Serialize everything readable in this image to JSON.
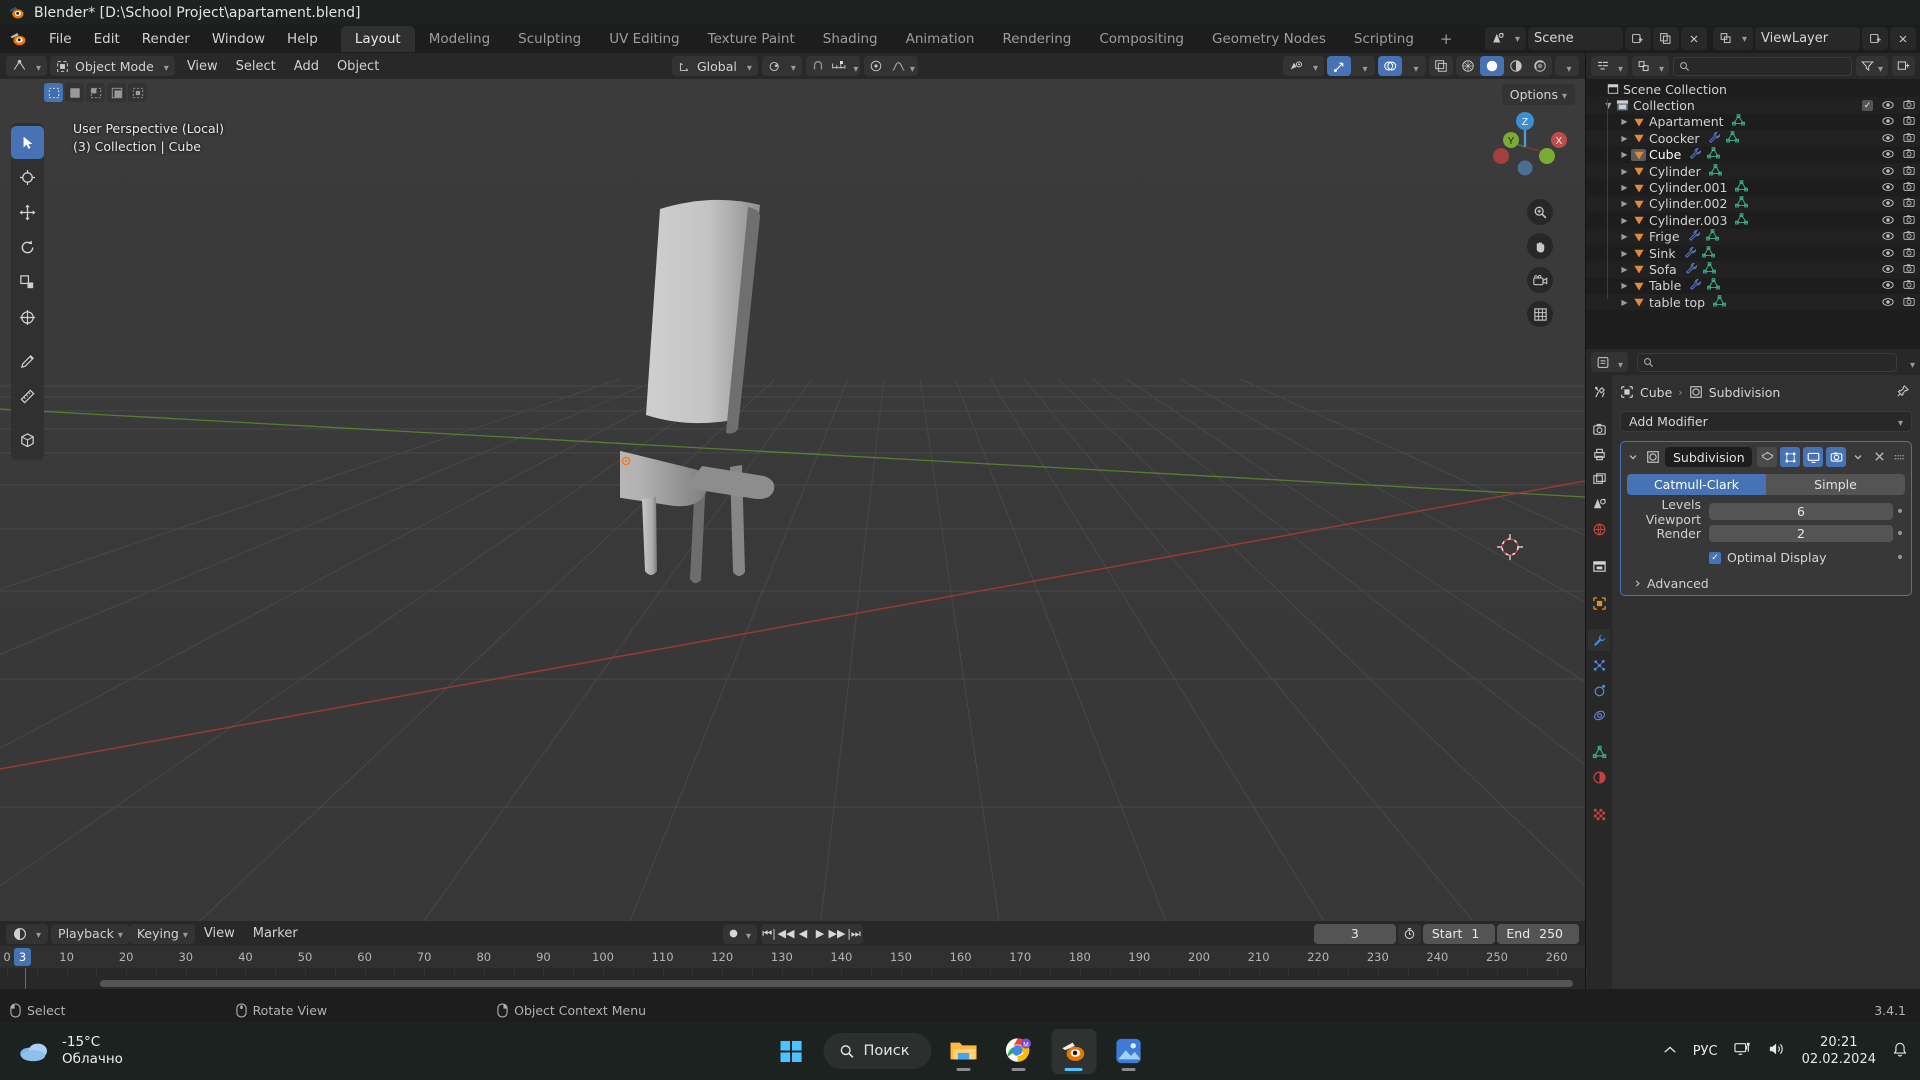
{
  "window": {
    "title": "Blender* [D:\\School Project\\apartament.blend]",
    "logo_icon": "blender-logo-icon"
  },
  "topbar": {
    "menus": [
      "File",
      "Edit",
      "Render",
      "Window",
      "Help"
    ],
    "workspaces": [
      {
        "label": "Layout",
        "active": true
      },
      {
        "label": "Modeling",
        "active": false
      },
      {
        "label": "Sculpting",
        "active": false
      },
      {
        "label": "UV Editing",
        "active": false
      },
      {
        "label": "Texture Paint",
        "active": false
      },
      {
        "label": "Shading",
        "active": false
      },
      {
        "label": "Animation",
        "active": false
      },
      {
        "label": "Rendering",
        "active": false
      },
      {
        "label": "Compositing",
        "active": false
      },
      {
        "label": "Geometry Nodes",
        "active": false
      },
      {
        "label": "Scripting",
        "active": false
      }
    ],
    "add_workspace_label": "+",
    "scene_name": "Scene",
    "viewlayer_name": "ViewLayer",
    "scene_icon": "scene-data-icon",
    "viewlayer_icon": "view-layer-icon",
    "new_scene_icon": "new-scene-icon",
    "copy_scene_icon": "copy-scene-icon",
    "delete_scene_icon": "delete-scene-icon",
    "new_viewlayer_icon": "new-viewlayer-icon",
    "delete_viewlayer_icon": "delete-viewlayer-icon"
  },
  "viewport": {
    "mode": "Object Mode",
    "mode_icon": "object-mode-icon",
    "editor_type_icon": "editor-type-3dview-icon",
    "menus": [
      "View",
      "Select",
      "Add",
      "Object"
    ],
    "transform_orientation": "Global",
    "orientation_icon": "transform-orientation-icon",
    "pivot_icon": "pivot-point-icon",
    "snap_icon": "snap-magnet-icon",
    "snap_target_icon": "snap-increment-icon",
    "proportional_icon": "proportional-edit-icon",
    "proportional_falloff_icon": "falloff-smooth-icon",
    "options_label": "Options",
    "select_modes": [
      "select-set-icon",
      "select-extend-icon",
      "select-subtract-icon",
      "select-invert-icon",
      "select-intersect-icon"
    ],
    "overlay_text_line1": "User Perspective (Local)",
    "overlay_text_line2": "(3) Collection | Cube",
    "gizmo_axes": [
      "X",
      "Y",
      "Z"
    ],
    "nav_buttons": [
      "zoom-icon",
      "pan-hand-icon",
      "camera-view-icon",
      "toggle-ortho-icon"
    ],
    "shading_modes": [
      "wireframe-icon",
      "solid-icon",
      "material-preview-icon",
      "rendered-icon"
    ],
    "active_shading_mode": "solid-icon",
    "header_right_toggles": [
      "visibility-eye-icon",
      "gizmo-toggle-icon",
      "overlays-toggle-icon",
      "xray-toggle-icon"
    ],
    "tools": [
      {
        "name": "tweak-select-box-tool",
        "active": true
      },
      {
        "name": "cursor-tool",
        "active": false
      },
      {
        "name": "move-tool",
        "active": false
      },
      {
        "name": "rotate-tool",
        "active": false
      },
      {
        "name": "scale-tool",
        "active": false
      },
      {
        "name": "transform-tool",
        "active": false
      },
      {
        "name": "annotate-tool",
        "active": false
      },
      {
        "name": "measure-tool",
        "active": false
      },
      {
        "name": "add-cube-tool",
        "active": false
      }
    ],
    "colors": {
      "background": "#393939",
      "grid": "#4b4b4b",
      "axis_x": "#a33b3b",
      "axis_y": "#5a8a2e",
      "object_origin": "#ef7b2f",
      "cursor": "#ffffff"
    }
  },
  "outliner": {
    "display_mode_icon": "outliner-view-layer-icon",
    "filter_icon": "filter-funnel-icon",
    "search_icon": "search-icon",
    "new_collection_icon": "new-collection-icon",
    "root": {
      "label": "Scene Collection",
      "icon": "scene-collection-icon"
    },
    "collection": {
      "label": "Collection",
      "icon": "collection-icon",
      "checked": true
    },
    "items": [
      {
        "label": "Apartament",
        "icon": "mesh-object-icon",
        "has_modifier": false,
        "has_mesh_data": true,
        "selected": false
      },
      {
        "label": "Coocker",
        "icon": "mesh-object-icon",
        "has_modifier": true,
        "has_mesh_data": true,
        "selected": false
      },
      {
        "label": "Cube",
        "icon": "mesh-object-icon",
        "has_modifier": true,
        "has_mesh_data": true,
        "selected": true
      },
      {
        "label": "Cylinder",
        "icon": "mesh-object-icon",
        "has_modifier": false,
        "has_mesh_data": true,
        "selected": false
      },
      {
        "label": "Cylinder.001",
        "icon": "mesh-object-icon",
        "has_modifier": false,
        "has_mesh_data": true,
        "selected": false
      },
      {
        "label": "Cylinder.002",
        "icon": "mesh-object-icon",
        "has_modifier": false,
        "has_mesh_data": true,
        "selected": false
      },
      {
        "label": "Cylinder.003",
        "icon": "mesh-object-icon",
        "has_modifier": false,
        "has_mesh_data": true,
        "selected": false
      },
      {
        "label": "Frige",
        "icon": "mesh-object-icon",
        "has_modifier": true,
        "has_mesh_data": true,
        "selected": false
      },
      {
        "label": "Sink",
        "icon": "mesh-object-icon",
        "has_modifier": true,
        "has_mesh_data": true,
        "selected": false
      },
      {
        "label": "Sofa",
        "icon": "mesh-object-icon",
        "has_modifier": true,
        "has_mesh_data": true,
        "selected": false
      },
      {
        "label": "Table",
        "icon": "mesh-object-icon",
        "has_modifier": true,
        "has_mesh_data": true,
        "selected": false
      },
      {
        "label": "table top",
        "icon": "mesh-object-icon",
        "has_modifier": false,
        "has_mesh_data": true,
        "selected": false
      }
    ],
    "row_icons": {
      "eye": "hide-eye-icon",
      "camera": "disable-render-camera-icon"
    }
  },
  "properties": {
    "editor_icon": "editor-type-properties-icon",
    "search_icon": "search-icon",
    "breadcrumb": {
      "object": "Cube",
      "object_icon": "object-data-icon",
      "separator": "›",
      "modifier": "Subdivision",
      "modifier_icon": "modifier-subsurf-icon",
      "pin_icon": "pin-icon"
    },
    "add_modifier_label": "Add Modifier",
    "add_modifier_chevron_icon": "chevron-down-icon",
    "tabs": [
      {
        "name": "tool-tab",
        "icon": "tool-screwdriver-wrench-icon",
        "active": false
      },
      {
        "name": "render-tab",
        "icon": "render-camera-back-icon",
        "active": false
      },
      {
        "name": "output-tab",
        "icon": "output-printer-icon",
        "active": false
      },
      {
        "name": "view-layer-tab",
        "icon": "view-layer-images-icon",
        "active": false
      },
      {
        "name": "scene-tab",
        "icon": "scene-cone-icon",
        "active": false
      },
      {
        "name": "world-tab",
        "icon": "world-globe-icon",
        "active": false
      },
      {
        "name": "collection-tab",
        "icon": "collection-box-icon",
        "active": false
      },
      {
        "name": "object-tab",
        "icon": "object-square-icon",
        "active": false
      },
      {
        "name": "modifier-tab",
        "icon": "modifier-wrench-icon",
        "active": true
      },
      {
        "name": "particles-tab",
        "icon": "particles-icon",
        "active": false
      },
      {
        "name": "physics-tab",
        "icon": "physics-orbit-icon",
        "active": false
      },
      {
        "name": "constraints-tab",
        "icon": "object-constraints-icon",
        "active": false
      },
      {
        "name": "data-tab",
        "icon": "mesh-data-triangle-icon",
        "active": false
      },
      {
        "name": "material-tab",
        "icon": "material-sphere-icon",
        "active": false
      },
      {
        "name": "texture-tab",
        "icon": "texture-checker-icon",
        "active": false
      }
    ],
    "modifier": {
      "expand_icon": "chevron-down-icon",
      "type_icon": "modifier-subsurf-icon",
      "name": "Subdivision",
      "toggles": [
        {
          "name": "on-cage-toggle",
          "icon": "on-cage-icon",
          "on": false
        },
        {
          "name": "edit-mode-toggle",
          "icon": "edit-mode-display-icon",
          "on": true
        },
        {
          "name": "realtime-toggle",
          "icon": "display-in-viewport-icon",
          "on": true
        },
        {
          "name": "render-toggle",
          "icon": "render-camera-icon",
          "on": true
        }
      ],
      "extras_icon": "chevron-down-icon",
      "close_icon": "close-x-icon",
      "drag_icon": "drag-dots-icon",
      "algorithm_options": [
        "Catmull-Clark",
        "Simple"
      ],
      "algorithm_selected": "Catmull-Clark",
      "fields": [
        {
          "label": "Levels Viewport",
          "value": "6"
        },
        {
          "label": "Render",
          "value": "2"
        }
      ],
      "optimal_display_label": "Optimal Display",
      "optimal_display_checked": true,
      "advanced_label": "Advanced",
      "advanced_expanded": false,
      "advanced_icon": "chevron-right-icon"
    },
    "accent_color": "#4772b3"
  },
  "timeline": {
    "editor_icon": "editor-type-timeline-icon",
    "menus": [
      "Playback",
      "Keying",
      "View",
      "Marker"
    ],
    "record_icon": "auto-keying-record-icon",
    "transport": [
      "jump-to-start-icon",
      "jump-to-prev-keyframe-icon",
      "play-reverse-icon",
      "play-icon",
      "jump-to-next-keyframe-icon",
      "jump-to-end-icon"
    ],
    "current_frame": "3",
    "frame_icon": "stopwatch-icon",
    "start_label": "Start",
    "start_value": "1",
    "end_label": "End",
    "end_value": "250",
    "ruler_ticks": [
      "0",
      "10",
      "20",
      "30",
      "40",
      "50",
      "60",
      "70",
      "80",
      "90",
      "100",
      "110",
      "120",
      "130",
      "140",
      "150",
      "160",
      "170",
      "180",
      "190",
      "200",
      "210",
      "220",
      "230",
      "240",
      "250",
      "260"
    ],
    "playhead_frame": "3"
  },
  "statusbar": {
    "items": [
      {
        "label": "Select",
        "icon": "mouse-left-button-icon"
      },
      {
        "label": "Rotate View",
        "icon": "mouse-middle-button-icon"
      },
      {
        "label": "Object Context Menu",
        "icon": "mouse-right-button-icon"
      }
    ],
    "version": "3.4.1"
  },
  "taskbar": {
    "weather": {
      "temperature": "-15°C",
      "condition": "Облачно",
      "icon": "cloud-icon"
    },
    "start_icon": "windows-start-icon",
    "search_placeholder": "Поиск",
    "search_icon": "search-icon",
    "apps": [
      {
        "name": "file-explorer-icon",
        "running": true,
        "active": false
      },
      {
        "name": "google-chrome-icon",
        "running": true,
        "active": false,
        "badge": "M"
      },
      {
        "name": "blender-icon",
        "running": true,
        "active": true
      },
      {
        "name": "photos-icon",
        "running": true,
        "active": false
      }
    ],
    "tray": {
      "overflow_icon": "chevron-up-icon",
      "language": "РУС",
      "network_icon": "network-icon",
      "volume_icon": "volume-icon",
      "time": "20:21",
      "date": "02.02.2024",
      "notification_icon": "bell-icon"
    }
  }
}
